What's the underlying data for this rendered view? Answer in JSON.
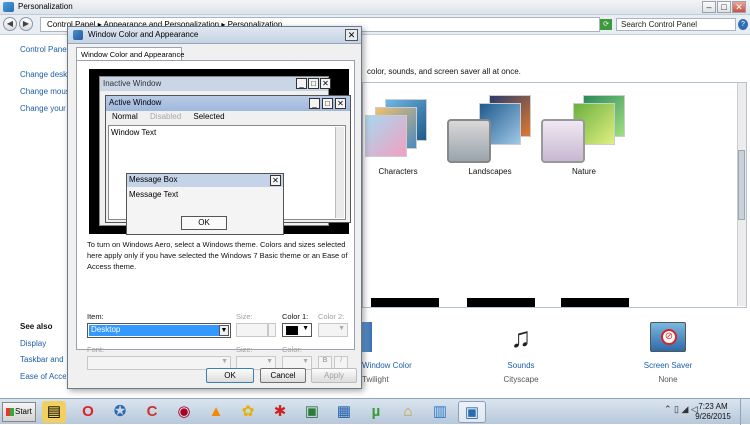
{
  "window": {
    "title": "Personalization"
  },
  "address": {
    "path": "Control Panel ▸ Appearance and Personalization ▸ Personalization",
    "search_placeholder": "Search Control Panel"
  },
  "left_pane": {
    "links": [
      "Control Panel Home",
      "Change desktop icons",
      "Change mouse pointers",
      "Change your account picture"
    ],
    "see_also_title": "See also",
    "see_also": [
      "Display",
      "Taskbar and Start Menu",
      "Ease of Access Center"
    ]
  },
  "main": {
    "subtitle": "color, sounds, and screen saver all at once.",
    "themes": [
      "Characters",
      "Landscapes",
      "Nature"
    ],
    "bottom": [
      {
        "label": "Window Color",
        "sub": "Twilight"
      },
      {
        "label": "Sounds",
        "sub": "Cityscape"
      },
      {
        "label": "Screen Saver",
        "sub": "None"
      }
    ]
  },
  "dialog": {
    "title": "Window Color and Appearance",
    "tab": "Window Color and Appearance",
    "preview": {
      "inactive_title": "Inactive Window",
      "active_title": "Active Window",
      "menu": [
        "Normal",
        "Disabled",
        "Selected"
      ],
      "window_text": "Window Text",
      "msg_title": "Message Box",
      "msg_text": "Message Text",
      "ok": "OK"
    },
    "aero_text": "To turn on Windows Aero, select a Windows theme.  Colors and sizes selected here apply only if you have selected the Windows 7 Basic theme or an Ease of Access theme.",
    "labels": {
      "item": "Item:",
      "size": "Size:",
      "color1": "Color 1:",
      "color2": "Color 2:",
      "font": "Font:",
      "fsize": "Size:",
      "fcolor": "Color:",
      "bold": "B",
      "italic": "I"
    },
    "item_value": "Desktop",
    "buttons": {
      "ok": "OK",
      "cancel": "Cancel",
      "apply": "Apply"
    }
  },
  "taskbar": {
    "start": "Start",
    "time": "7:23 AM",
    "date": "9/26/2015"
  },
  "colors": {
    "accent": "#3399ff",
    "link": "#1d5ea8"
  }
}
